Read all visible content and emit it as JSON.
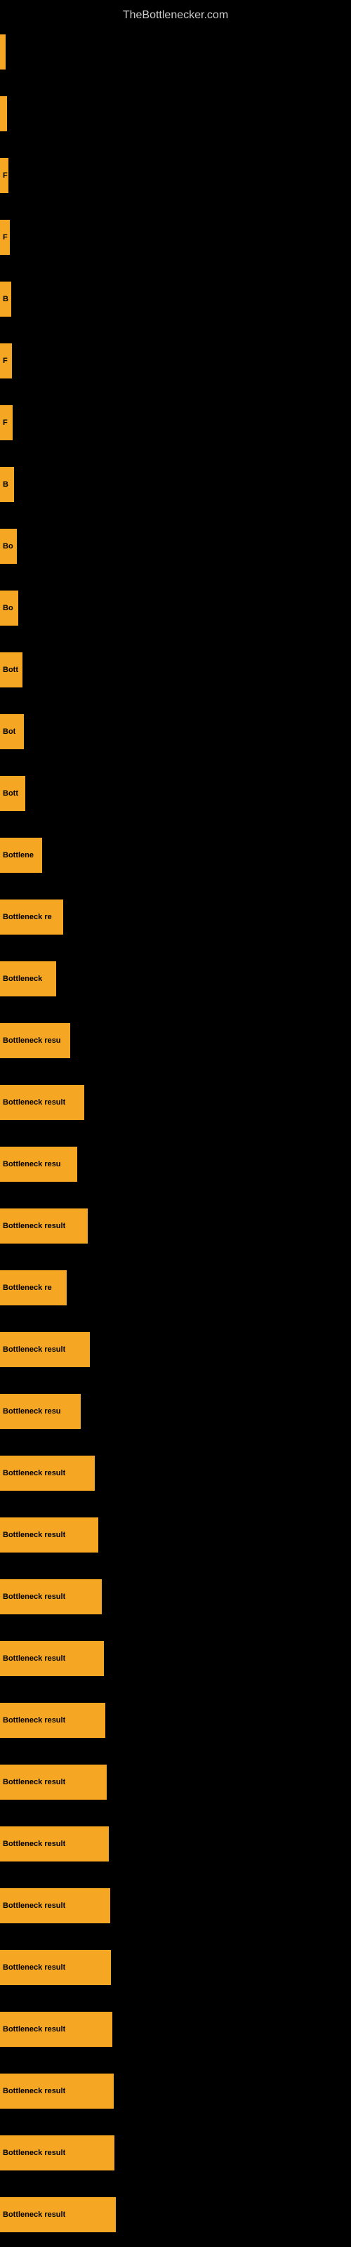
{
  "site": {
    "title": "TheBottlenecker.com"
  },
  "bars": [
    {
      "label": "",
      "width": 8
    },
    {
      "label": "",
      "width": 10
    },
    {
      "label": "F",
      "width": 12
    },
    {
      "label": "F",
      "width": 14
    },
    {
      "label": "B",
      "width": 16
    },
    {
      "label": "F",
      "width": 17
    },
    {
      "label": "F",
      "width": 18
    },
    {
      "label": "B",
      "width": 20
    },
    {
      "label": "Bo",
      "width": 24
    },
    {
      "label": "Bo",
      "width": 26
    },
    {
      "label": "Bott",
      "width": 32
    },
    {
      "label": "Bot",
      "width": 34
    },
    {
      "label": "Bott",
      "width": 36
    },
    {
      "label": "Bottlene",
      "width": 60
    },
    {
      "label": "Bottleneck re",
      "width": 90
    },
    {
      "label": "Bottleneck",
      "width": 80
    },
    {
      "label": "Bottleneck resu",
      "width": 100
    },
    {
      "label": "Bottleneck result",
      "width": 120
    },
    {
      "label": "Bottleneck resu",
      "width": 110
    },
    {
      "label": "Bottleneck result",
      "width": 125
    },
    {
      "label": "Bottleneck re",
      "width": 95
    },
    {
      "label": "Bottleneck result",
      "width": 128
    },
    {
      "label": "Bottleneck resu",
      "width": 115
    },
    {
      "label": "Bottleneck result",
      "width": 135
    },
    {
      "label": "Bottleneck result",
      "width": 140
    },
    {
      "label": "Bottleneck result",
      "width": 145
    },
    {
      "label": "Bottleneck result",
      "width": 148
    },
    {
      "label": "Bottleneck result",
      "width": 150
    },
    {
      "label": "Bottleneck result",
      "width": 152
    },
    {
      "label": "Bottleneck result",
      "width": 155
    },
    {
      "label": "Bottleneck result",
      "width": 157
    },
    {
      "label": "Bottleneck result",
      "width": 158
    },
    {
      "label": "Bottleneck result",
      "width": 160
    },
    {
      "label": "Bottleneck result",
      "width": 162
    },
    {
      "label": "Bottleneck result",
      "width": 163
    },
    {
      "label": "Bottleneck result",
      "width": 165
    }
  ]
}
